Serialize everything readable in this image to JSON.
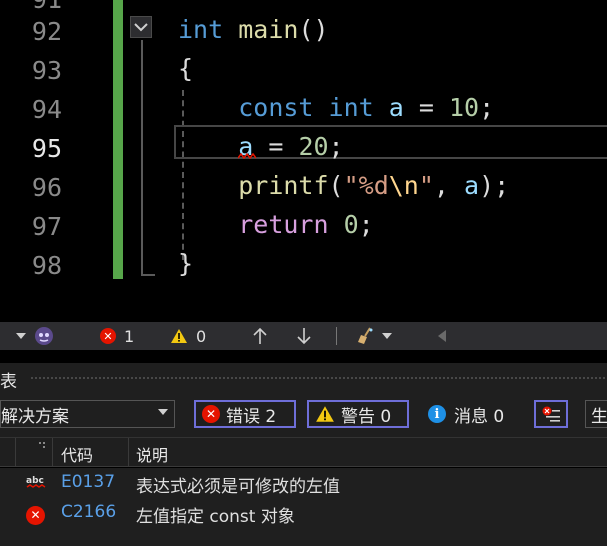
{
  "editor": {
    "line_numbers": [
      "91",
      "92",
      "93",
      "94",
      "95",
      "96",
      "97",
      "98"
    ],
    "current_line": "95",
    "lines": [
      {
        "segments": [
          {
            "t": "int",
            "c": "kw"
          },
          {
            "t": " ",
            "c": "pl"
          },
          {
            "t": "main",
            "c": "fn"
          },
          {
            "t": "()",
            "c": "pl"
          }
        ]
      },
      {
        "segments": [
          {
            "t": "{",
            "c": "pl"
          }
        ]
      },
      {
        "segments": [
          {
            "t": "    ",
            "c": "pl"
          },
          {
            "t": "const",
            "c": "kw"
          },
          {
            "t": " ",
            "c": "pl"
          },
          {
            "t": "int",
            "c": "kw"
          },
          {
            "t": " ",
            "c": "pl"
          },
          {
            "t": "a",
            "c": "var"
          },
          {
            "t": " = ",
            "c": "pl"
          },
          {
            "t": "10",
            "c": "num"
          },
          {
            "t": ";",
            "c": "pl"
          }
        ]
      },
      {
        "segments": [
          {
            "t": "    ",
            "c": "pl"
          },
          {
            "t": "a",
            "c": "var"
          },
          {
            "t": " = ",
            "c": "pl"
          },
          {
            "t": "20",
            "c": "num"
          },
          {
            "t": ";",
            "c": "pl"
          }
        ]
      },
      {
        "segments": [
          {
            "t": "    ",
            "c": "pl"
          },
          {
            "t": "printf",
            "c": "fn"
          },
          {
            "t": "(",
            "c": "pl"
          },
          {
            "t": "\"%d",
            "c": "str"
          },
          {
            "t": "\\n",
            "c": "esc"
          },
          {
            "t": "\"",
            "c": "str"
          },
          {
            "t": ", ",
            "c": "pl"
          },
          {
            "t": "a",
            "c": "var"
          },
          {
            "t": ");",
            "c": "pl"
          }
        ]
      },
      {
        "segments": [
          {
            "t": "    ",
            "c": "pl"
          },
          {
            "t": "return",
            "c": "ctl"
          },
          {
            "t": " ",
            "c": "pl"
          },
          {
            "t": "0",
            "c": "num"
          },
          {
            "t": ";",
            "c": "pl"
          }
        ]
      },
      {
        "segments": [
          {
            "t": "}",
            "c": "pl"
          }
        ]
      }
    ]
  },
  "strip": {
    "error_count": "1",
    "warning_count": "0"
  },
  "error_list": {
    "title_fragment": "表",
    "scope_value": "解决方案",
    "errors_label": "错误 2",
    "warnings_label": "警告 0",
    "messages_label": "消息 0",
    "build_fragment": "生",
    "columns": {
      "code": "代码",
      "description": "说明"
    },
    "rows": [
      {
        "icon": "spell-abc-icon",
        "code": "E0137",
        "description": "表达式必须是可修改的左值"
      },
      {
        "icon": "error-icon",
        "code": "C2166",
        "description": "左值指定 const 对象"
      }
    ]
  },
  "colors": {
    "change_bar": "#57a64a",
    "filter_border": "#6e6ed8",
    "error": "#e51400",
    "warning": "#f2c811",
    "info": "#1e90e6",
    "code_link": "#5aa0e8"
  }
}
